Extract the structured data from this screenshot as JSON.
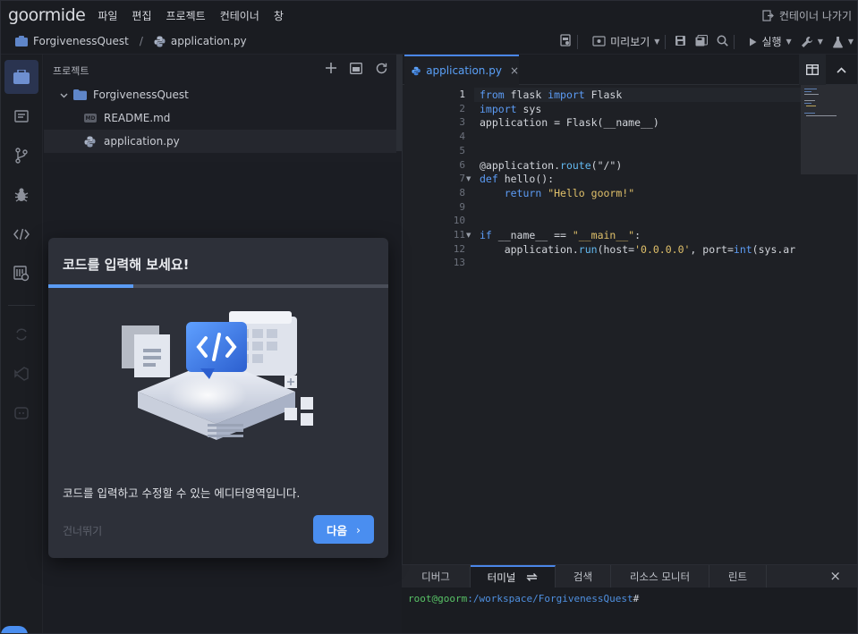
{
  "app": {
    "logo": "goormide",
    "menu": [
      "파일",
      "편집",
      "프로젝트",
      "컨테이너",
      "창"
    ],
    "exit_label": "컨테이너 나가기"
  },
  "toolbar": {
    "project": "ForgivenessQuest",
    "separator": "/",
    "file": "application.py",
    "preview_label": "미리보기",
    "run_label": "실행"
  },
  "explorer": {
    "title": "프로젝트",
    "tree": [
      {
        "label": "ForgivenessQuest",
        "type": "folder",
        "expanded": true
      },
      {
        "label": "README.md",
        "type": "markdown",
        "badge": "MD"
      },
      {
        "label": "application.py",
        "type": "python",
        "selected": true
      }
    ]
  },
  "editor": {
    "tab_label": "application.py",
    "tab_close": "×",
    "line_numbers": [
      "1",
      "2",
      "3",
      "4",
      "5",
      "6",
      "7",
      "8",
      "9",
      "10",
      "11",
      "12",
      "13"
    ],
    "current_line": "1",
    "lines": [
      [
        {
          "t": "from",
          "c": "kw"
        },
        {
          "t": " flask ",
          "c": ""
        },
        {
          "t": "import",
          "c": "kw"
        },
        {
          "t": " Flask",
          "c": ""
        }
      ],
      [
        {
          "t": "import",
          "c": "kw"
        },
        {
          "t": " sys",
          "c": ""
        }
      ],
      [
        {
          "t": "application = Flask(__name__)",
          "c": ""
        }
      ],
      [],
      [],
      [
        {
          "t": "@application.",
          "c": ""
        },
        {
          "t": "route",
          "c": "fn"
        },
        {
          "t": "(\"/\")",
          "c": ""
        }
      ],
      [
        {
          "t": "def",
          "c": "kw"
        },
        {
          "t": " hello():",
          "c": ""
        }
      ],
      [
        {
          "t": "    ",
          "c": ""
        },
        {
          "t": "return",
          "c": "kw"
        },
        {
          "t": " ",
          "c": ""
        },
        {
          "t": "\"Hello goorm!\"",
          "c": "str"
        }
      ],
      [],
      [],
      [
        {
          "t": "if",
          "c": "kw"
        },
        {
          "t": " __name__ == ",
          "c": ""
        },
        {
          "t": "\"__main__\"",
          "c": "str"
        },
        {
          "t": ":",
          "c": ""
        }
      ],
      [
        {
          "t": "    application.",
          "c": ""
        },
        {
          "t": "run",
          "c": "fn"
        },
        {
          "t": "(host=",
          "c": ""
        },
        {
          "t": "'0.0.0.0'",
          "c": "str"
        },
        {
          "t": ", port=",
          "c": ""
        },
        {
          "t": "int",
          "c": "bi"
        },
        {
          "t": "(sys.ar",
          "c": ""
        }
      ],
      []
    ]
  },
  "panel": {
    "tabs": [
      "디버그",
      "터미널",
      "검색",
      "리소스 모니터",
      "린트"
    ],
    "active_tab": "터미널",
    "close": "×",
    "terminal": {
      "user": "root@goorm",
      "path": ":/workspace/ForgivenessQuest",
      "prompt": "#"
    }
  },
  "dialog": {
    "title": "코드를 입력해 보세요!",
    "progress": 0.25,
    "body": "코드를 입력하고 수정할 수 있는 에디터영역입니다.",
    "skip_label": "건너뛰기",
    "next_label": "다음",
    "next_chevron": "›"
  },
  "colors": {
    "accent": "#4a8ef0",
    "background": "#1b1d23",
    "dialog": "#2d3039"
  }
}
